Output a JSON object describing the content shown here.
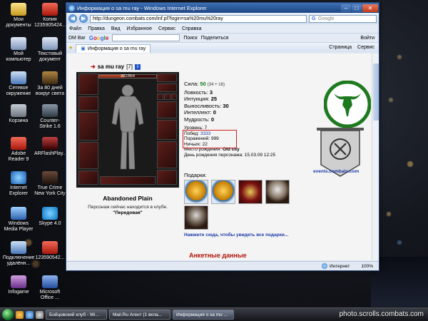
{
  "desktop": {
    "icons": [
      {
        "label": "Мои документы"
      },
      {
        "label": "Копия 1235905424..."
      },
      {
        "label": "Мой компьютер"
      },
      {
        "label": "Текстовый документ"
      },
      {
        "label": "Сетевое окружение"
      },
      {
        "label": "За 80 дней вокруг света"
      },
      {
        "label": "Корзина"
      },
      {
        "label": "Counter-Strike 1.6"
      },
      {
        "label": "Adobe Reader 9"
      },
      {
        "label": "ARFlashPlay..."
      },
      {
        "label": "Internet Explorer"
      },
      {
        "label": "True Crime New York City"
      },
      {
        "label": "Windows Media Player"
      },
      {
        "label": "Skype 4.0"
      },
      {
        "label": "Подключение удалённ..."
      },
      {
        "label": "123590542..."
      },
      {
        "label": "Infogame"
      },
      {
        "label": "Microsoft Office ..."
      }
    ]
  },
  "window": {
    "title": "Информация о sa mu ray - Windows Internet Explorer",
    "url": "http://dungeon.combats.com/inf.pl?login=sa%20mu%20ray",
    "search_placeholder": "Google",
    "menu": [
      "Файл",
      "Правка",
      "Вид",
      "Избранное",
      "Сервис",
      "Справка"
    ],
    "toolbar": {
      "dm_bar": "DM Bar",
      "search_btn": "Поиск",
      "share_btn": "Поделиться",
      "signin": "Войти"
    },
    "tab_label": "Информация о sa mu ray",
    "right_tools": [
      "Страница",
      "Сервис"
    ]
  },
  "character": {
    "nick": "sa mu ray",
    "level": "[7]",
    "info_icon": "i",
    "hp_text": "382/864",
    "hp_fraction": 0.44,
    "name_plate": "Abandoned Plain",
    "location_text": "Персонаж сейчас находится в клубе.",
    "room": "\"Передовая\""
  },
  "stats": {
    "strength_label": "Сила:",
    "strength_value": "50",
    "strength_bonus": "(34 + 16)",
    "agility_label": "Ловкость:",
    "agility_value": "3",
    "intuition_label": "Интуиция:",
    "intuition_value": "25",
    "endurance_label": "Выносливость:",
    "endurance_value": "30",
    "intellect_label": "Интеллект:",
    "intellect_value": "0",
    "wisdom_label": "Мудрость:",
    "wisdom_value": "0"
  },
  "record": {
    "level_label": "Уровень:",
    "level_value": "7",
    "wins_label": "Побед:",
    "wins_value": "3333",
    "losses_label": "Поражений:",
    "losses_value": "999",
    "draws_label": "Ничьих:",
    "draws_value": "22",
    "birthplace_label": "Место рождения:",
    "birthplace_value": "Old city",
    "birthday_label": "День рождения персонажа:",
    "birthday_value": "15.03.09 12:25"
  },
  "gifts": {
    "label": "Подарки:",
    "more_link": "Нажмите сюда, чтобы увидеть все подарки..."
  },
  "clan": {
    "events_link": "events.combats.com"
  },
  "anketa_title": "Анкетные данные",
  "statusbar": {
    "zone": "Интернет",
    "zoom": "100%"
  },
  "taskbar": {
    "buttons": [
      {
        "label": "Бойцовский клуб - Wi..."
      },
      {
        "label": "Mail.Ru Агент (1 вкла..."
      },
      {
        "label": "Информация о sa mu ..."
      }
    ]
  },
  "watermark": "photo.scrolls.combats.com",
  "colors": {
    "ie_title": "#1c4585",
    "link_blue": "#1a3caa",
    "anketa_red": "#b0140a",
    "record_box": "#d02020",
    "clan_green": "#1e7a1e"
  }
}
